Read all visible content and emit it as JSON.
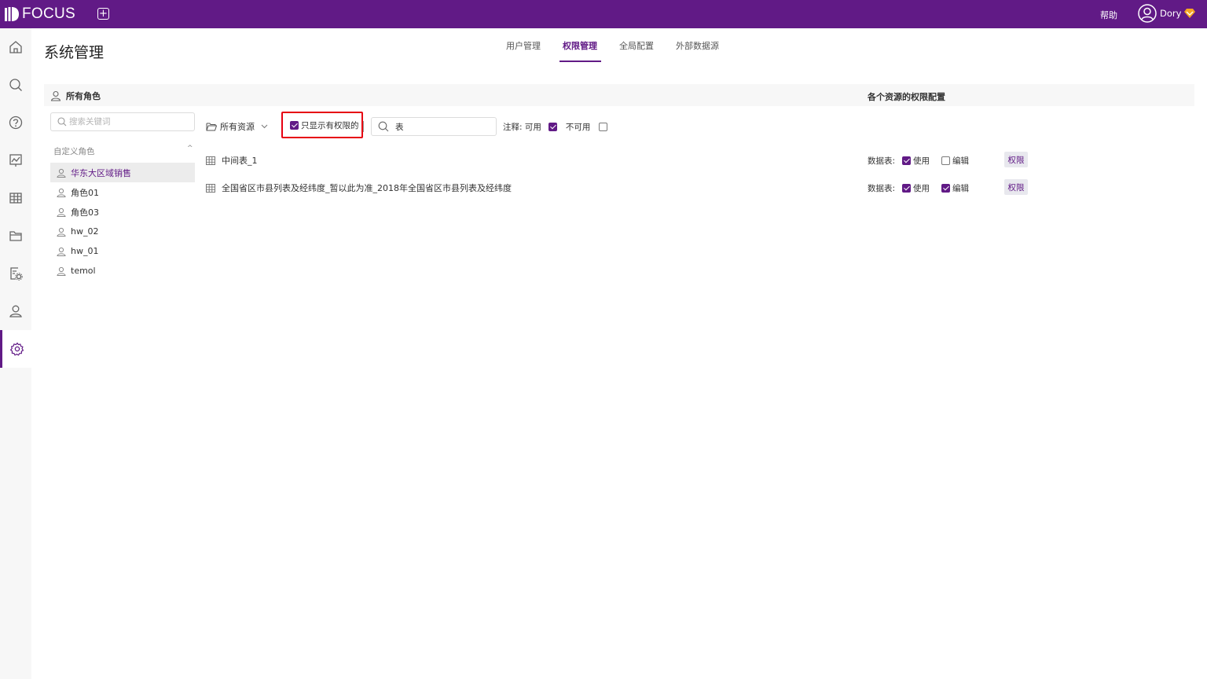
{
  "topbar": {
    "brand": "FOCUS",
    "help": "帮助",
    "username": "Dory",
    "colors": {
      "bar": "#611a86",
      "badge": "#f5a623"
    }
  },
  "leftnav": {
    "items": [
      {
        "icon": "home-icon"
      },
      {
        "icon": "search-icon"
      },
      {
        "icon": "question-icon"
      },
      {
        "icon": "chart-board-icon"
      },
      {
        "icon": "table-icon"
      },
      {
        "icon": "folder-icon"
      },
      {
        "icon": "settings-file-icon"
      },
      {
        "icon": "user-icon"
      },
      {
        "icon": "gear-icon",
        "active": true
      }
    ]
  },
  "page": {
    "title": "系统管理",
    "tabs": [
      {
        "label": "用户管理"
      },
      {
        "label": "权限管理",
        "active": true
      },
      {
        "label": "全局配置"
      },
      {
        "label": "外部数据源"
      }
    ]
  },
  "panel": {
    "left_header": "所有角色",
    "right_header": "各个资源的权限配置"
  },
  "roles": {
    "search_placeholder": "搜索关键词",
    "group_title": "自定义角色",
    "items": [
      {
        "label": "华东大区域销售",
        "selected": true
      },
      {
        "label": "角色01"
      },
      {
        "label": "角色03"
      },
      {
        "label": "hw_02"
      },
      {
        "label": "hw_01"
      },
      {
        "label": "temol"
      }
    ]
  },
  "toolbar": {
    "resource_dropdown": "所有资源",
    "only_with_permission": "只显示有权限的",
    "only_with_permission_checked": true,
    "search_value": "表",
    "legend_label": "注释: 可用",
    "legend_unavailable": "不可用"
  },
  "resources": [
    {
      "name": "中间表_1",
      "type_label": "数据表:",
      "use_label": "使用",
      "use_checked": true,
      "edit_label": "编辑",
      "edit_checked": false,
      "perm_button": "权限"
    },
    {
      "name": "全国省区市县列表及经纬度_暂以此为准_2018年全国省区市县列表及经纬度",
      "type_label": "数据表:",
      "use_label": "使用",
      "use_checked": true,
      "edit_label": "编辑",
      "edit_checked": true,
      "perm_button": "权限"
    }
  ]
}
